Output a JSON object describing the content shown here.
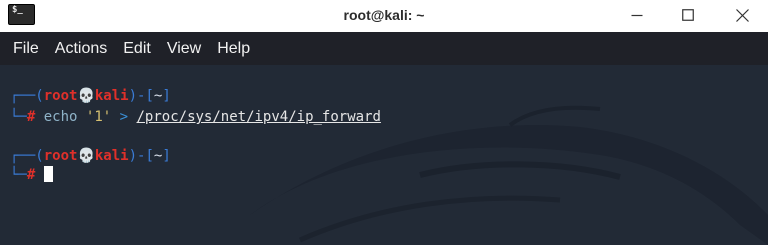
{
  "window": {
    "title": "root@kali: ~",
    "icon_label": "$_"
  },
  "menu": {
    "items": [
      "File",
      "Actions",
      "Edit",
      "View",
      "Help"
    ]
  },
  "terminal": {
    "prompt1": {
      "corner": "┌──(",
      "user": "root",
      "skull": "💀",
      "host": "kali",
      "mid": ")-[",
      "dir": "~",
      "end": "]"
    },
    "line1": {
      "corner": "└─",
      "hash": "#",
      "cmd": "echo",
      "arg": "'1'",
      "op": ">",
      "path": "/proc/sys/net/ipv4/ip_forward"
    },
    "prompt2": {
      "corner": "┌──(",
      "user": "root",
      "skull": "💀",
      "host": "kali",
      "mid": ")-[",
      "dir": "~",
      "end": "]"
    },
    "line2": {
      "corner": "└─",
      "hash": "#"
    }
  },
  "colors": {
    "titlebar": "#ffffff",
    "menubar": "#1f2128",
    "terminal_bg": "#222a36",
    "prompt_blue": "#3a7bd5",
    "prompt_red": "#e0302a"
  },
  "icons": [
    "terminal-app-icon",
    "minimize-icon",
    "maximize-icon",
    "close-icon",
    "skull-icon"
  ]
}
